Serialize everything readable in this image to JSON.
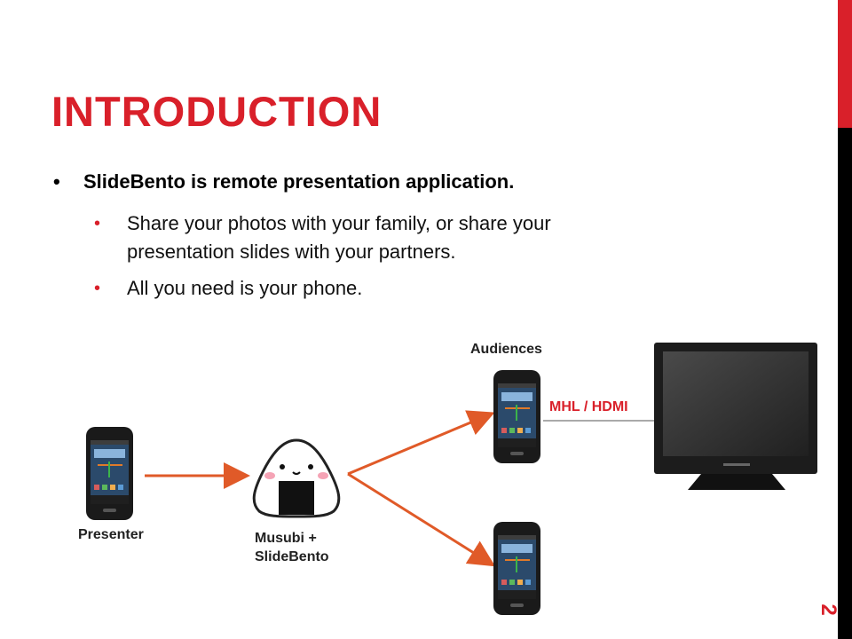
{
  "slide": {
    "title": "INTRODUCTION",
    "page_number": "2",
    "accent_color": "#d9202a"
  },
  "bullets": {
    "main": "SlideBento is remote presentation application.",
    "sub": [
      "Share your photos with your family, or share your presentation slides with your partners.",
      "All you need is your phone."
    ]
  },
  "diagram": {
    "presenter_label": "Presenter",
    "musubi_label_line1": "Musubi +",
    "musubi_label_line2": "SlideBento",
    "audiences_label": "Audiences",
    "connection_label": "MHL  / HDMI",
    "icons": [
      "phone-icon",
      "rice-ball-mascot-icon",
      "tv-icon",
      "arrow-icon"
    ]
  }
}
